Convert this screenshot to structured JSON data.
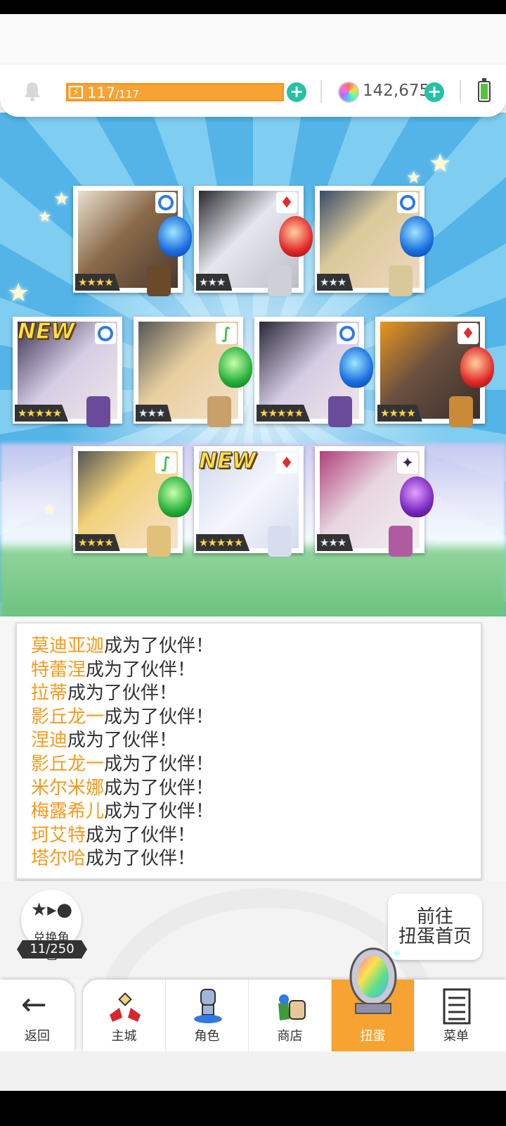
{
  "status": {
    "energy_current": "117",
    "energy_max": "/117",
    "gems": "142,675"
  },
  "banner": {
    "new_label": "NEW",
    "cards": [
      {
        "rarity": "★★★★",
        "element": "water"
      },
      {
        "rarity": "★★★",
        "element": "fire"
      },
      {
        "rarity": "★★★",
        "element": "water"
      },
      {
        "rarity": "★★★★★",
        "element": "water",
        "is_new": true
      },
      {
        "rarity": "★★★",
        "element": "wind"
      },
      {
        "rarity": "★★★★★",
        "element": "water"
      },
      {
        "rarity": "★★★★",
        "element": "fire"
      },
      {
        "rarity": "★★★★",
        "element": "wind"
      },
      {
        "rarity": "★★★★★",
        "element": "fire",
        "is_new": true
      },
      {
        "rarity": "★★★",
        "element": "dark"
      }
    ]
  },
  "log": {
    "suffix": "成为了伙伴！",
    "entries": [
      "莫迪亚迦",
      "特蕾涅",
      "拉蒂",
      "影丘龙一",
      "涅迪",
      "影丘龙一",
      "米尔米娜",
      "梅露希儿",
      "珂艾特",
      "塔尔哈"
    ]
  },
  "exchange": {
    "label": "兑换角色",
    "count": "11/250"
  },
  "goto_button": {
    "line1": "前往",
    "line2": "扭蛋首页"
  },
  "nav": {
    "back": "返回",
    "tabs": [
      "主城",
      "角色",
      "商店",
      "扭蛋",
      "菜单"
    ],
    "active_index": 3
  },
  "colors": {
    "accent_orange": "#f7a331",
    "plus_teal": "#25c1a5",
    "name_orange": "#f39a1e"
  }
}
